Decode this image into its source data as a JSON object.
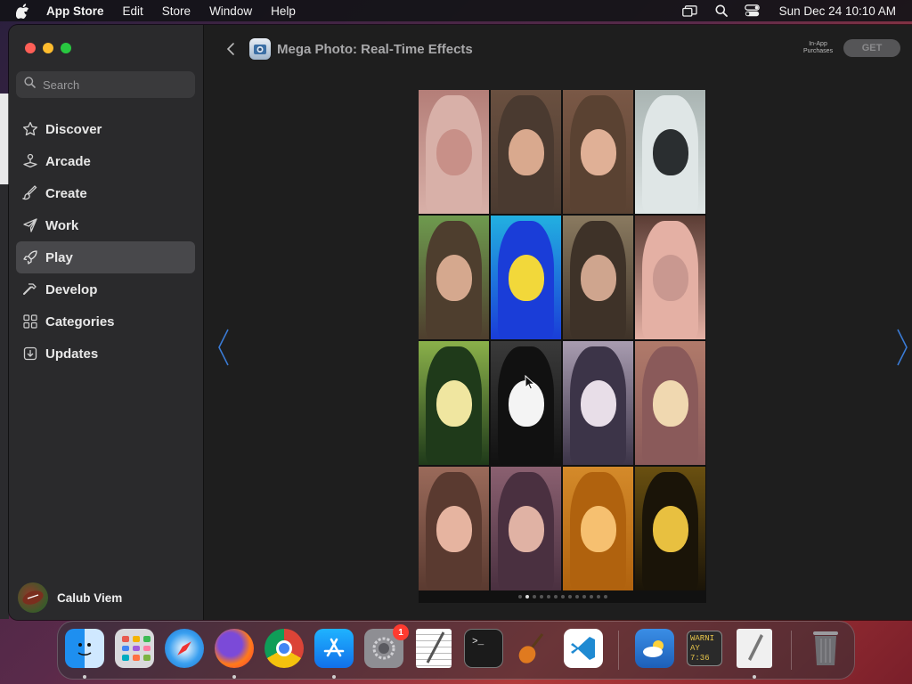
{
  "menubar": {
    "app_name": "App Store",
    "items": [
      "Edit",
      "Store",
      "Window",
      "Help"
    ],
    "clock": "Sun Dec 24  10:10 AM",
    "icons": [
      "screen-mirroring-icon",
      "search-icon",
      "control-center-icon"
    ]
  },
  "sidebar": {
    "search_placeholder": "Search",
    "items": [
      {
        "label": "Discover",
        "icon": "star-icon"
      },
      {
        "label": "Arcade",
        "icon": "joystick-icon"
      },
      {
        "label": "Create",
        "icon": "brush-icon"
      },
      {
        "label": "Work",
        "icon": "paper-plane-icon"
      },
      {
        "label": "Play",
        "icon": "rocket-icon",
        "active": true
      },
      {
        "label": "Develop",
        "icon": "hammer-icon"
      },
      {
        "label": "Categories",
        "icon": "grid-icon"
      },
      {
        "label": "Updates",
        "icon": "download-icon"
      }
    ],
    "user_name": "Calub Viem"
  },
  "product": {
    "title": "Mega Photo: Real-Time Effects",
    "iap_line1": "In-App",
    "iap_line2": "Purchases",
    "get_label": "GET"
  },
  "screenshot": {
    "page_count": 13,
    "active_page": 2
  },
  "dock": {
    "apps": [
      {
        "name": "Finder",
        "icon": "finder-icon",
        "running": true
      },
      {
        "name": "Launchpad",
        "icon": "launchpad-icon",
        "running": false
      },
      {
        "name": "Safari",
        "icon": "safari-icon",
        "running": false
      },
      {
        "name": "Firefox",
        "icon": "firefox-icon",
        "running": true
      },
      {
        "name": "Chrome",
        "icon": "chrome-icon",
        "running": false
      },
      {
        "name": "App Store",
        "icon": "app-store-icon",
        "running": true
      },
      {
        "name": "System Settings",
        "icon": "settings-icon",
        "running": false,
        "badge": "1"
      },
      {
        "name": "TextEdit",
        "icon": "textedit-icon",
        "running": false
      },
      {
        "name": "Terminal",
        "icon": "terminal-icon",
        "running": false
      },
      {
        "name": "GarageBand",
        "icon": "guitar-icon",
        "running": false
      },
      {
        "name": "VS Code",
        "icon": "vscode-icon",
        "running": false
      },
      {
        "name": "Weather",
        "icon": "weather-icon",
        "running": false
      },
      {
        "name": "Console",
        "icon": "console-icon",
        "running": false,
        "text_line1": "WARNI",
        "text_line2": "AY 7:36"
      },
      {
        "name": "Script Editor",
        "icon": "script-editor-icon",
        "running": true
      },
      {
        "name": "Trash",
        "icon": "trash-icon",
        "running": false
      }
    ]
  }
}
